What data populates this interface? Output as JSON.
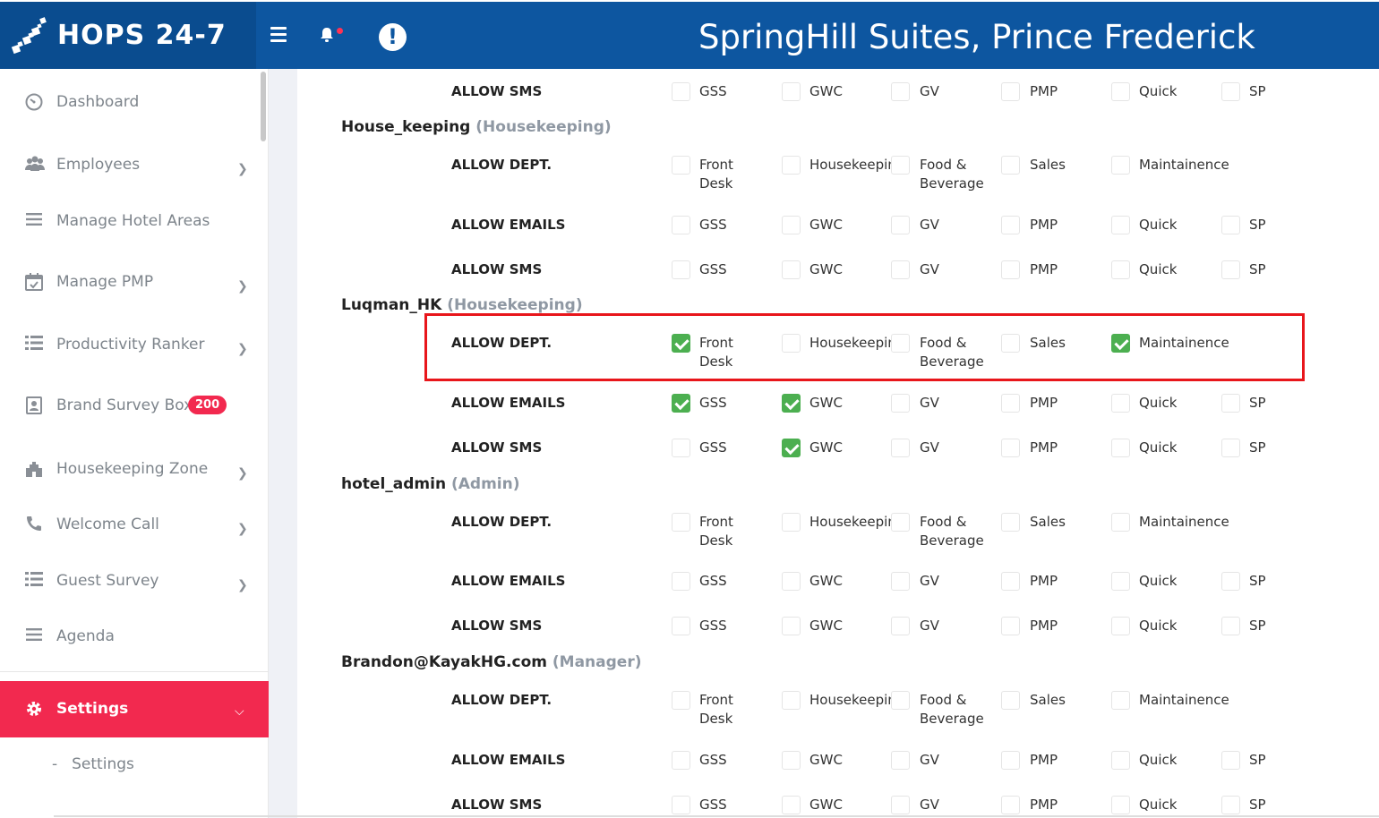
{
  "header": {
    "logo_text": "HOPS 24-7",
    "hotel_name": "SpringHill Suites, Prince Frederick",
    "alert_symbol": "!",
    "brand_color": "#0d56a0",
    "accent_color": "#f2294f"
  },
  "sidebar": {
    "items": [
      {
        "label": "Dashboard",
        "icon": "dashboard-icon"
      },
      {
        "label": "Employees",
        "icon": "users-icon"
      },
      {
        "label": "Manage Hotel Areas",
        "icon": "list-icon"
      },
      {
        "label": "Manage PMP",
        "icon": "calendar-check-icon"
      },
      {
        "label": "Productivity Ranker",
        "icon": "list-icon"
      },
      {
        "label": "Brand Survey Box",
        "icon": "contact-card-icon",
        "badge": "200"
      },
      {
        "label": "Housekeeping Zone",
        "icon": "building-icon"
      },
      {
        "label": "Welcome Call",
        "icon": "phone-icon"
      },
      {
        "label": "Guest Survey",
        "icon": "list-icon"
      },
      {
        "label": "Agenda",
        "icon": "list-icon"
      }
    ],
    "active": {
      "label": "Settings",
      "icon": "gear-icon"
    },
    "sub_items": [
      {
        "label": "Settings"
      }
    ]
  },
  "labels": {
    "allow_dept": "ALLOW DEPT.",
    "allow_emails": "ALLOW EMAILS",
    "allow_sms": "ALLOW SMS"
  },
  "dept_options": [
    [
      "Front",
      "Desk"
    ],
    [
      "Housekeepin"
    ],
    [
      "Food &",
      "Beverage"
    ],
    [
      "Sales"
    ],
    [
      "Maintainence"
    ]
  ],
  "comm_options": [
    "GSS",
    "GWC",
    "GV",
    "PMP",
    "Quick",
    "SP"
  ],
  "users": [
    {
      "name": "House_keeping",
      "role": "(Housekeeping)"
    },
    {
      "name": "Luqman_HK",
      "role": "(Housekeeping)"
    },
    {
      "name": "hotel_admin",
      "role": "(Admin)"
    },
    {
      "name": "Brandon@KayakHG.com",
      "role": "(Manager)"
    }
  ],
  "permissions": {
    "top_sms": [
      false,
      false,
      false,
      false,
      false,
      false
    ],
    "house_keeping": {
      "dept": [
        false,
        false,
        false,
        false,
        false
      ],
      "emails": [
        false,
        false,
        false,
        false,
        false,
        false
      ],
      "sms": [
        false,
        false,
        false,
        false,
        false,
        false
      ]
    },
    "luqman_hk": {
      "dept": [
        true,
        false,
        false,
        false,
        true
      ],
      "emails": [
        true,
        true,
        false,
        false,
        false,
        false
      ],
      "sms": [
        false,
        true,
        false,
        false,
        false,
        false
      ]
    },
    "hotel_admin": {
      "dept": [
        false,
        false,
        false,
        false,
        false
      ],
      "emails": [
        false,
        false,
        false,
        false,
        false,
        false
      ],
      "sms": [
        false,
        false,
        false,
        false,
        false,
        false
      ]
    },
    "brandon": {
      "dept": [
        false,
        false,
        false,
        false,
        false
      ],
      "emails": [
        false,
        false,
        false,
        false,
        false,
        false
      ],
      "sms": [
        false,
        false,
        false,
        false,
        false,
        false
      ]
    }
  }
}
